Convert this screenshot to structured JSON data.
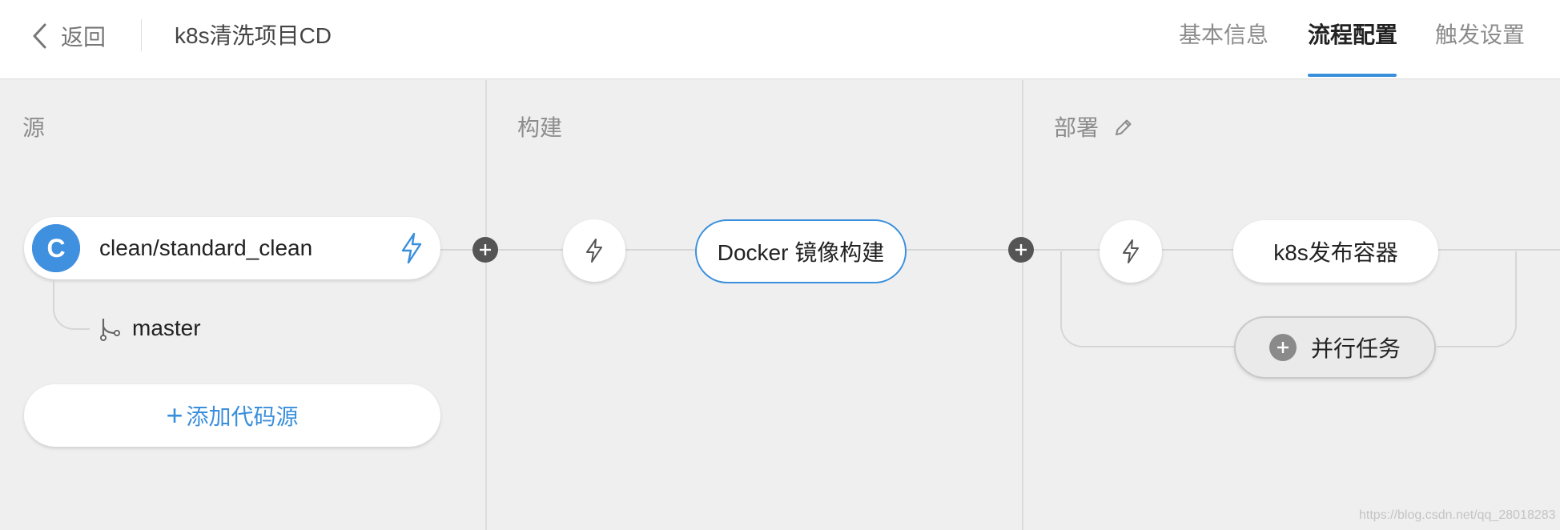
{
  "header": {
    "back_label": "返回",
    "title": "k8s清洗项目CD",
    "tabs": [
      {
        "label": "基本信息",
        "active": false
      },
      {
        "label": "流程配置",
        "active": true
      },
      {
        "label": "触发设置",
        "active": false
      }
    ]
  },
  "stages": {
    "source": {
      "label": "源",
      "repo_name": "clean/standard_clean",
      "repo_logo_letter": "C",
      "branch": "master",
      "add_source_label": "添加代码源"
    },
    "build": {
      "label": "构建",
      "job_label": "Docker 镜像构建"
    },
    "deploy": {
      "label": "部署",
      "job_label": "k8s发布容器",
      "parallel_label": "并行任务"
    }
  },
  "watermark": "https://blog.csdn.net/qq_28018283",
  "colors": {
    "accent": "#3a8fdc",
    "canvas_bg": "#efefef",
    "connector": "#d6d6d6",
    "plus_node": "#555555"
  },
  "icons": [
    "chevron-left-icon",
    "pencil-icon",
    "lightning-icon",
    "git-branch-icon",
    "plus-icon"
  ]
}
